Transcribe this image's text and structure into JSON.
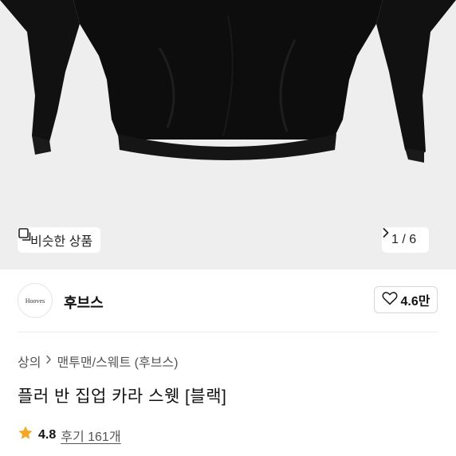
{
  "hero": {
    "similar_label": "비슷한 상품",
    "similar_icon": "similar-products-icon",
    "counter": "1 / 6",
    "next_icon": "chevron-right-icon",
    "background": "#eeeeee",
    "garment_color": "#0d0d0d"
  },
  "brand": {
    "logo_text": "Hooves",
    "name": "후브스",
    "like_icon": "heart-outline-icon",
    "like_count": "4.6만"
  },
  "breadcrumb": {
    "items": [
      "상의",
      "맨투맨/스웨트 (후브스)"
    ],
    "separator_icon": "chevron-right-icon"
  },
  "product": {
    "title": "플러 반 집업 카라 스웻 [블랙]"
  },
  "rating": {
    "icon": "star-icon",
    "star_color": "#f5a623",
    "value": "4.8",
    "review_label": "후기 161개"
  }
}
